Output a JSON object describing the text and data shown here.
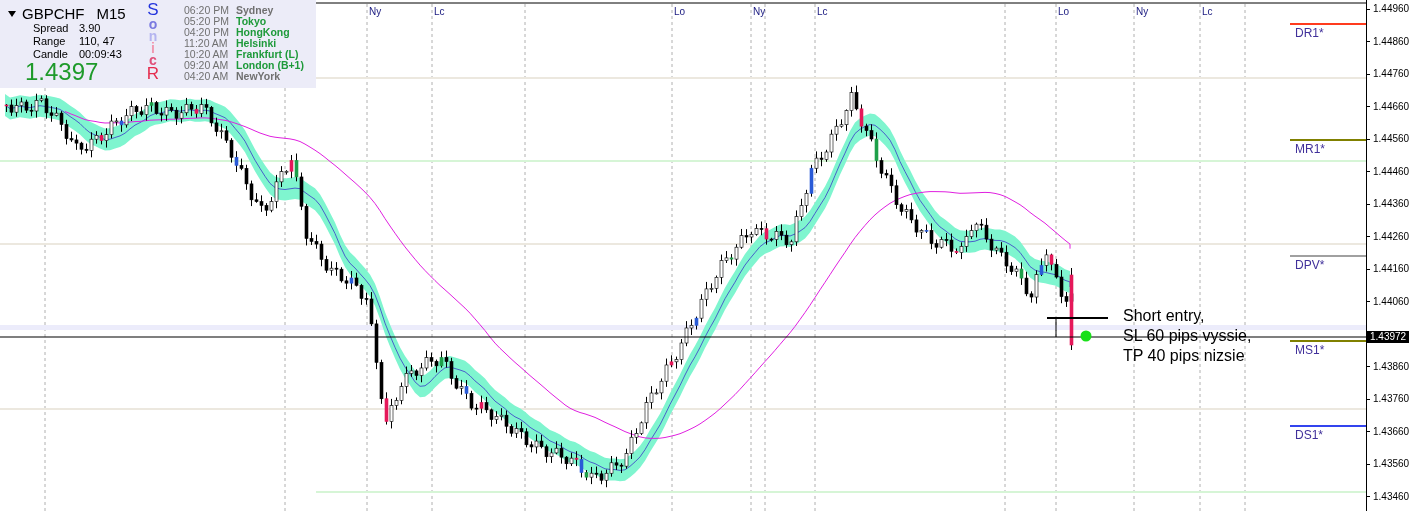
{
  "symbol_panel": {
    "expanded": true,
    "symbol": "GBPCHF",
    "timeframe": "M15",
    "stats": [
      {
        "label": "Spread",
        "value": "3.90"
      },
      {
        "label": "Range",
        "value": "110, 47"
      },
      {
        "label": "Candle",
        "value": "00:09:43"
      }
    ],
    "price": "1.4397"
  },
  "sonic_letters": [
    {
      "text": "S",
      "color": "#2233dd"
    },
    {
      "text": "o",
      "color": "#7a7ae0"
    },
    {
      "text": "n",
      "color": "#b4b4f0"
    },
    {
      "text": "i",
      "color": "#f098b0"
    },
    {
      "text": "c",
      "color": "#e0507a"
    },
    {
      "text": "R",
      "color": "#e52d4f"
    }
  ],
  "sessions": [
    {
      "time": "06:20 PM",
      "city": "Sydney",
      "color": "#707070"
    },
    {
      "time": "05:20 PM",
      "city": "Tokyo",
      "color": "#1e9a3a"
    },
    {
      "time": "04:20 PM",
      "city": "HongKong",
      "color": "#1e9a3a"
    },
    {
      "time": "11:20 AM",
      "city": "Helsinki",
      "color": "#1e9a3a"
    },
    {
      "time": "10:20 AM",
      "city": "Frankfurt  (L)",
      "color": "#1e9a3a"
    },
    {
      "time": "09:20 AM",
      "city": "London  (B+1)",
      "color": "#1e9a3a"
    },
    {
      "time": "04:20 AM",
      "city": "NewYork",
      "color": "#707070"
    }
  ],
  "session_markers": [
    "Ny",
    "Lc",
    "Lo",
    "Ny",
    "Lc",
    "Lo",
    "Ny",
    "Lc"
  ],
  "pivot_levels": [
    {
      "label": "DR1*",
      "color": "#ff3b1e"
    },
    {
      "label": "MR1*",
      "color": "#808000"
    },
    {
      "label": "DPV*",
      "color": "#a0a0a0"
    },
    {
      "label": "MS1*",
      "color": "#808000"
    },
    {
      "label": "DS1*",
      "color": "#3344ee"
    }
  ],
  "price_axis": [
    "1.44960",
    "1.44860",
    "1.44760",
    "1.44660",
    "1.44560",
    "1.44460",
    "1.44360",
    "1.44260",
    "1.44160",
    "1.44060",
    "1.43860",
    "1.43760",
    "1.43660",
    "1.43560",
    "1.43460"
  ],
  "current_price": "1.43972",
  "annotation": [
    "Short entry,",
    "SL 60 pips vyssie,",
    "TP 40 pips nizsie"
  ]
}
